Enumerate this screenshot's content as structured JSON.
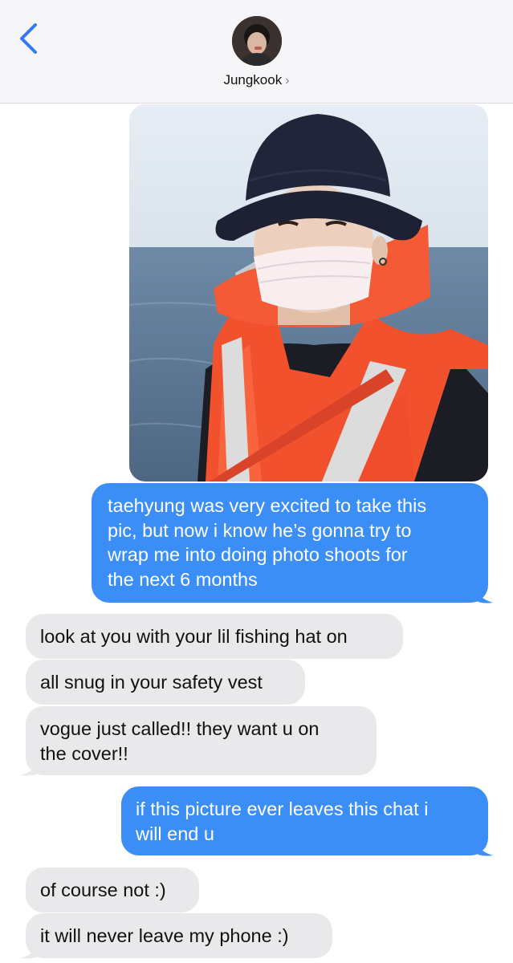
{
  "header": {
    "contact_name": "Jungkook",
    "chevron": "›",
    "back_icon": "chevron-left-icon",
    "avatar_icon": "contact-avatar"
  },
  "colors": {
    "sent_bubble": "#3a8ef6",
    "received_bubble": "#e9e9eb",
    "accent": "#3478f6"
  },
  "messages": [
    {
      "type": "image",
      "from": "me",
      "description_icon": "photo-attachment"
    },
    {
      "type": "text",
      "from": "me",
      "lines": [
        "taehyung was very excited to take this",
        "pic, but now i know he’s gonna try to",
        "wrap me into doing photo shoots for",
        "the next 6 months"
      ]
    },
    {
      "type": "text",
      "from": "them",
      "lines": [
        "look at you with your lil fishing hat on"
      ]
    },
    {
      "type": "text",
      "from": "them",
      "lines": [
        "all snug in your safety vest"
      ]
    },
    {
      "type": "text",
      "from": "them",
      "lines": [
        "vogue just called!! they want u on",
        "the cover!!"
      ]
    },
    {
      "type": "text",
      "from": "me",
      "lines": [
        "if this picture ever leaves this chat i",
        "will end u"
      ]
    },
    {
      "type": "text",
      "from": "them",
      "lines": [
        "of course not :)"
      ]
    },
    {
      "type": "text",
      "from": "them",
      "lines": [
        "it will never leave my phone :)"
      ]
    }
  ]
}
